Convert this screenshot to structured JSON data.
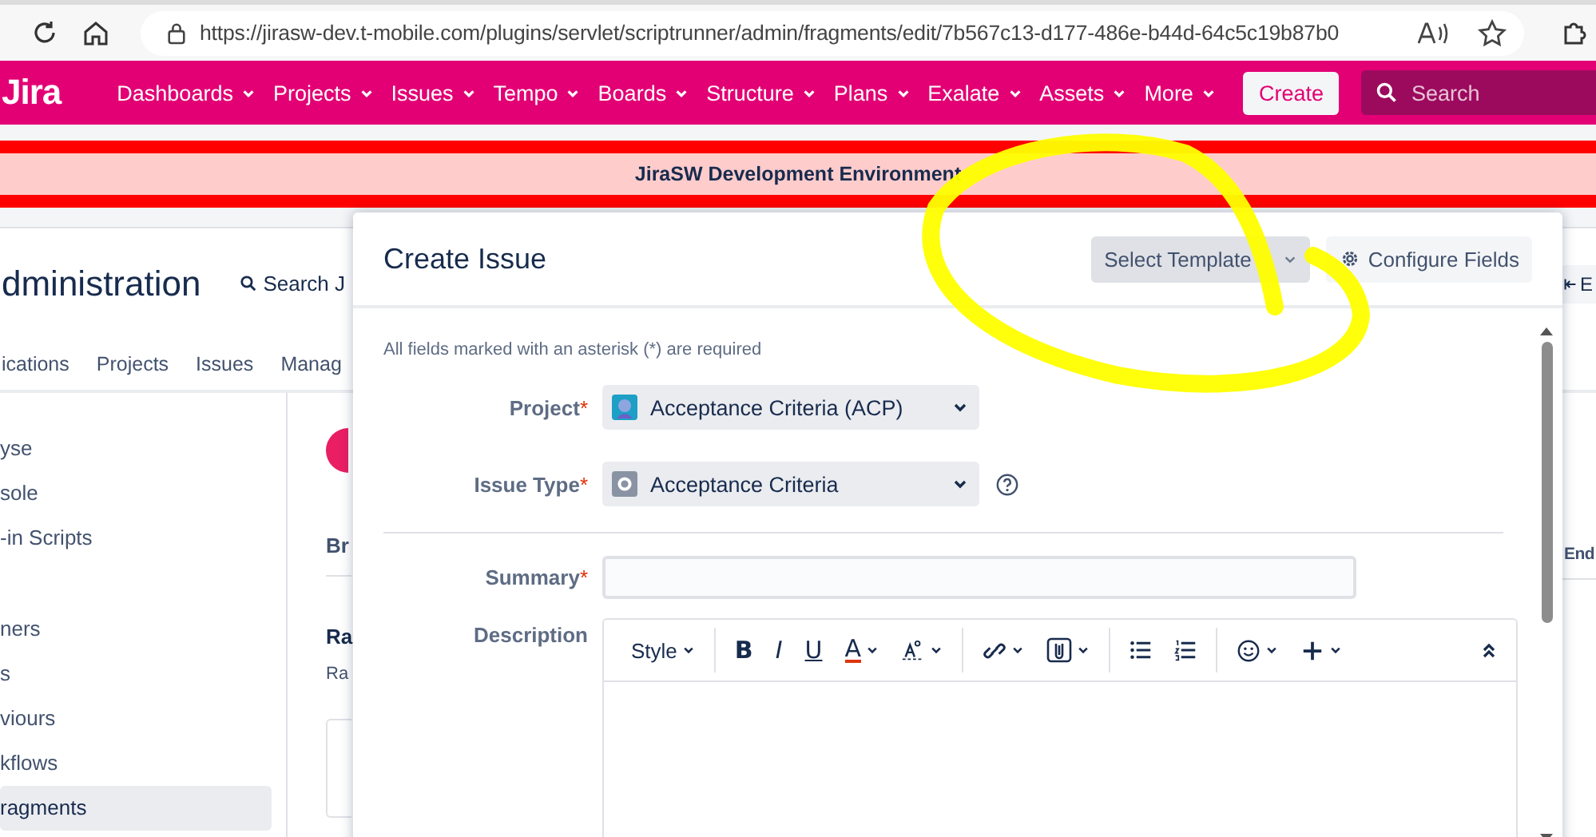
{
  "browser": {
    "url": "https://jirasw-dev.t-mobile.com/plugins/servlet/scriptrunner/admin/fragments/edit/7b567c13-d177-486e-b44d-64c5c19b87b0"
  },
  "nav": {
    "logo": "Jira",
    "items": [
      {
        "label": "Dashboards"
      },
      {
        "label": "Projects"
      },
      {
        "label": "Issues"
      },
      {
        "label": "Tempo"
      },
      {
        "label": "Boards"
      },
      {
        "label": "Structure"
      },
      {
        "label": "Plans"
      },
      {
        "label": "Exalate"
      },
      {
        "label": "Assets"
      },
      {
        "label": "More"
      }
    ],
    "create": "Create",
    "search": {
      "placeholder": "Search"
    }
  },
  "banner": "JiraSW Development Environment",
  "admin": {
    "title": "dministration",
    "search": "Search J",
    "tabs": [
      "ications",
      "Projects",
      "Issues",
      "Manag"
    ],
    "sidebar": [
      {
        "items": [
          {
            "label": "yse",
            "selected": false
          },
          {
            "label": "sole",
            "selected": false
          },
          {
            "label": "-in Scripts",
            "selected": false
          }
        ]
      },
      {
        "items": [
          {
            "label": "ners",
            "selected": false
          },
          {
            "label": "s",
            "selected": false
          },
          {
            "label": "viours",
            "selected": false
          },
          {
            "label": "kflows",
            "selected": false
          },
          {
            "label": "ragments",
            "selected": true
          }
        ]
      }
    ],
    "main": {
      "tab": "Br",
      "heading": "Ra",
      "text": "Ra"
    },
    "right": {
      "button": "E",
      "column": "End"
    }
  },
  "dialog": {
    "title": "Create Issue",
    "template": "Select Template",
    "configure": "Configure Fields",
    "note": "All fields marked with an asterisk (*) are required",
    "issue_fields": [
      {
        "kind": "select",
        "label": "Project",
        "mark": "*",
        "value": "Acceptance Criteria (ACP)",
        "help": false
      },
      {
        "kind": "select",
        "label": "Issue Type",
        "mark": "*",
        "value": "Acceptance Criteria",
        "help": true
      }
    ],
    "detail_fields": [
      {
        "kind": "text",
        "label": "Summary",
        "mark": "*"
      },
      {
        "kind": "editor",
        "label": "Description"
      }
    ],
    "toolbar": [
      [
        {
          "kind": "style",
          "label": "Style",
          "menu": true
        }
      ],
      [
        {
          "kind": "bold",
          "label": "B",
          "menu": false
        },
        {
          "kind": "italic",
          "label": "I",
          "menu": false
        },
        {
          "kind": "underline",
          "label": "U",
          "menu": false
        },
        {
          "kind": "color",
          "label": "A",
          "menu": true
        },
        {
          "kind": "format",
          "menu": true
        }
      ],
      [
        {
          "kind": "link",
          "menu": true
        },
        {
          "kind": "attach",
          "menu": true
        }
      ],
      [
        {
          "kind": "bullets",
          "menu": false
        },
        {
          "kind": "numbers",
          "menu": false
        }
      ],
      [
        {
          "kind": "emoji",
          "menu": true
        },
        {
          "kind": "plus",
          "menu": true
        }
      ]
    ]
  }
}
